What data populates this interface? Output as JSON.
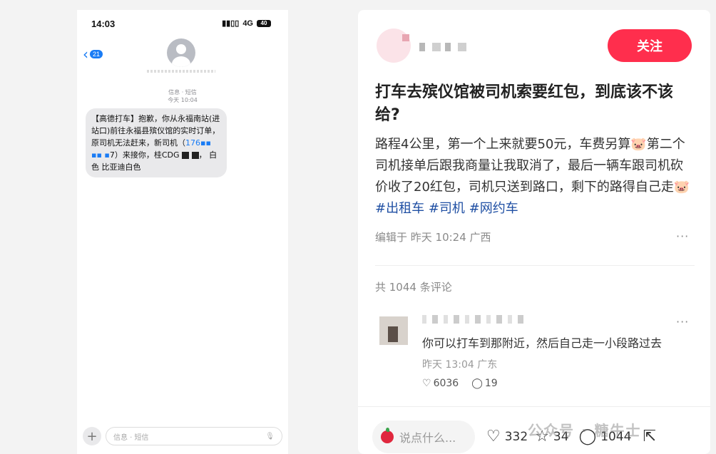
{
  "phone": {
    "status_time": "14:03",
    "status_net": "4G",
    "battery": "40",
    "back_count": "21",
    "meta_line1": "信息 · 短信",
    "meta_line2": "今天 10:04",
    "sms_text_part1": "【高德打车】抱歉，你从永福南站(进站口)前往永福县殡仪馆的实时订单，原司机无法赶来，新司机（",
    "sms_phone": "176",
    "sms_text_part2": "7）来接你，桂CDG",
    "sms_text_part3": "白色 比亚迪白色",
    "input_placeholder": "信息 · 短信"
  },
  "post": {
    "follow_label": "关注",
    "title": "打车去殡仪馆被司机索要红包，到底该不该给?",
    "body": "路程4公里，第一个上来就要50元，车费另算🐷第二个司机接单后跟我商量让我取消了，最后一辆车跟司机砍价收了20红包，司机只送到路口，剩下的路得自己走🐷",
    "tags": [
      "#出租车",
      "#司机",
      "#网约车"
    ],
    "edit_info": "编辑于 昨天 10:24 广西",
    "comment_count_text": "共 1044 条评论",
    "comment": {
      "text": "你可以打车到那附近，然后自己走一小段路过去",
      "time": "昨天 13:04 广东",
      "likes": "6036",
      "replies": "19"
    },
    "comment_input_placeholder": "说点什么...",
    "likes": "332",
    "stars": "34",
    "comments": "1044",
    "watermark": "公众号 · 糖牛士"
  }
}
